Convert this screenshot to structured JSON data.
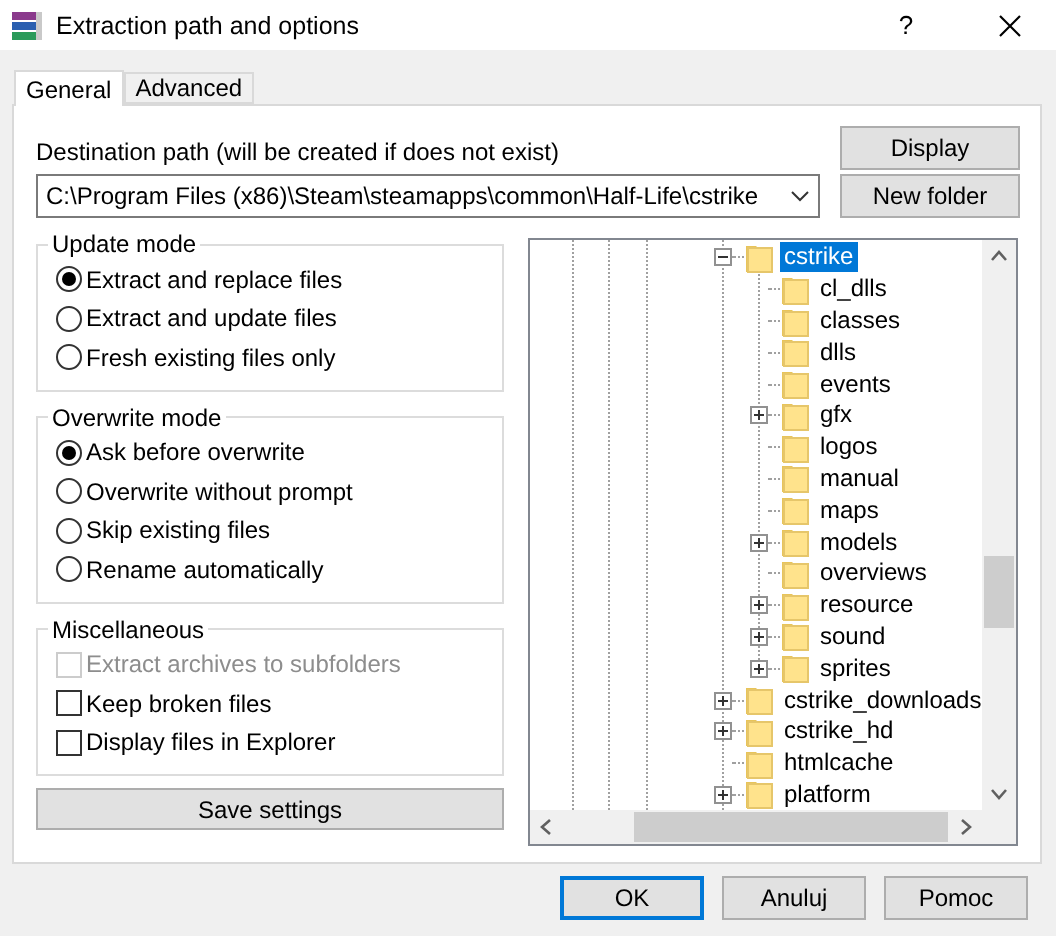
{
  "window": {
    "title": "Extraction path and options",
    "help": "?"
  },
  "tabs": [
    {
      "label": "General",
      "selected": true
    },
    {
      "label": "Advanced",
      "selected": false
    }
  ],
  "destination": {
    "label": "Destination path (will be created if does not exist)",
    "value": "C:\\Program Files (x86)\\Steam\\steamapps\\common\\Half-Life\\cstrike"
  },
  "side_buttons": [
    "Display",
    "New folder"
  ],
  "update_mode": {
    "title": "Update mode",
    "options": [
      {
        "label": "Extract and replace files",
        "selected": true
      },
      {
        "label": "Extract and update files",
        "selected": false
      },
      {
        "label": "Fresh existing files only",
        "selected": false
      }
    ]
  },
  "overwrite_mode": {
    "title": "Overwrite mode",
    "options": [
      {
        "label": "Ask before overwrite",
        "selected": true
      },
      {
        "label": "Overwrite without prompt",
        "selected": false
      },
      {
        "label": "Skip existing files",
        "selected": false
      },
      {
        "label": "Rename automatically",
        "selected": false
      }
    ]
  },
  "miscellaneous": {
    "title": "Miscellaneous",
    "options": [
      {
        "label": "Extract archives to subfolders",
        "checked": false,
        "disabled": true
      },
      {
        "label": "Keep broken files",
        "checked": false,
        "disabled": false
      },
      {
        "label": "Display files in Explorer",
        "checked": false,
        "disabled": false
      }
    ]
  },
  "save_button": "Save settings",
  "folder_tree": {
    "items": [
      {
        "label": "cstrike",
        "expandable": true,
        "expanded": true,
        "selected": true,
        "children": [
          {
            "label": "cl_dlls",
            "expandable": false,
            "selected": false
          },
          {
            "label": "classes",
            "expandable": false,
            "selected": false
          },
          {
            "label": "dlls",
            "expandable": false,
            "selected": false
          },
          {
            "label": "events",
            "expandable": false,
            "selected": false
          },
          {
            "label": "gfx",
            "expandable": true,
            "expanded": false,
            "selected": false
          },
          {
            "label": "logos",
            "expandable": false,
            "selected": false
          },
          {
            "label": "manual",
            "expandable": false,
            "selected": false
          },
          {
            "label": "maps",
            "expandable": false,
            "selected": false
          },
          {
            "label": "models",
            "expandable": true,
            "expanded": false,
            "selected": false
          },
          {
            "label": "overviews",
            "expandable": false,
            "selected": false
          },
          {
            "label": "resource",
            "expandable": true,
            "expanded": false,
            "selected": false
          },
          {
            "label": "sound",
            "expandable": true,
            "expanded": false,
            "selected": false
          },
          {
            "label": "sprites",
            "expandable": true,
            "expanded": false,
            "selected": false
          }
        ]
      },
      {
        "label": "cstrike_downloads",
        "expandable": true,
        "expanded": false,
        "selected": false
      },
      {
        "label": "cstrike_hd",
        "expandable": true,
        "expanded": false,
        "selected": false
      },
      {
        "label": "htmlcache",
        "expandable": false,
        "selected": false
      },
      {
        "label": "platform",
        "expandable": true,
        "expanded": false,
        "selected": false
      }
    ]
  },
  "footer_buttons": [
    {
      "label": "OK",
      "default": true
    },
    {
      "label": "Anuluj",
      "default": false
    },
    {
      "label": "Pomoc",
      "default": false
    }
  ]
}
